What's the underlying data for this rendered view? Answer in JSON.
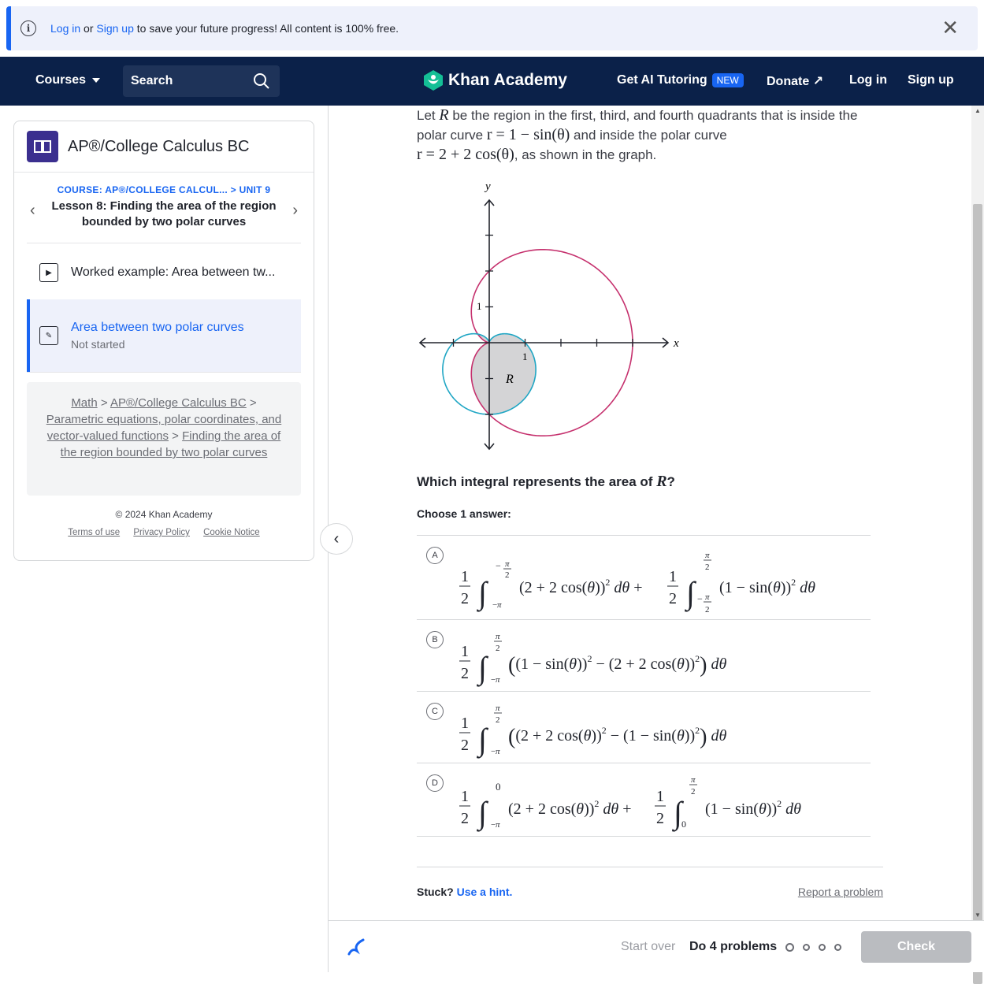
{
  "banner": {
    "login": "Log in",
    "or": "or",
    "signup": "Sign up",
    "rest": "to save your future progress! All content is 100% free."
  },
  "nav": {
    "courses": "Courses",
    "search_placeholder": "Search",
    "brand": "Khan Academy",
    "ai_tutoring": "Get AI Tutoring",
    "ai_badge": "NEW",
    "donate": "Donate",
    "login": "Log in",
    "signup": "Sign up"
  },
  "sidebar": {
    "course_title": "AP®/College Calculus BC",
    "crumb_course": "COURSE: AP®/COLLEGE CALCUL...",
    "crumb_unit": "> UNIT 9",
    "lesson_title": "Lesson 8: Finding the area of the region bounded by two polar curves",
    "items": [
      {
        "label": "Worked example: Area between tw...",
        "status": ""
      },
      {
        "label": "Area between two polar curves",
        "status": "Not started"
      }
    ],
    "breadcrumbs": [
      "Math",
      "AP®/College Calculus BC",
      "Parametric equations, polar coordinates, and vector-valued functions",
      "Finding the area of the region bounded by two polar curves"
    ],
    "copyright": "© 2024 Khan Academy",
    "terms": "Terms of use",
    "privacy": "Privacy Policy",
    "cookie": "Cookie Notice"
  },
  "exercise": {
    "prompt_pre": "Let",
    "prompt_1": "be the region in the first, third, and fourth quadrants that is inside the polar curve",
    "prompt_2": "and inside the polar curve",
    "prompt_3": ", as shown in the graph.",
    "R": "R",
    "curve1": "r = 1 − sin(θ)",
    "curve2": "r = 2 + 2 cos(θ)",
    "graph": {
      "xlabel": "x",
      "ylabel": "y",
      "tick_one_y": "1",
      "tick_one_x": "1",
      "region_label": "R"
    },
    "question_pre": "Which integral represents the area of",
    "question_post": "?",
    "choose": "Choose 1 answer:",
    "choices": [
      {
        "letter": "A"
      },
      {
        "letter": "B"
      },
      {
        "letter": "C"
      },
      {
        "letter": "D"
      }
    ],
    "stuck": "Stuck?",
    "hint": "Use a hint.",
    "report": "Report a problem"
  },
  "footer": {
    "start_over": "Start over",
    "do_problems": "Do 4 problems",
    "check": "Check"
  },
  "colors": {
    "accent": "#1865f2",
    "nav_bg": "#0b2149",
    "curve_pink": "#c5306d",
    "curve_blue": "#1fa6c4"
  }
}
